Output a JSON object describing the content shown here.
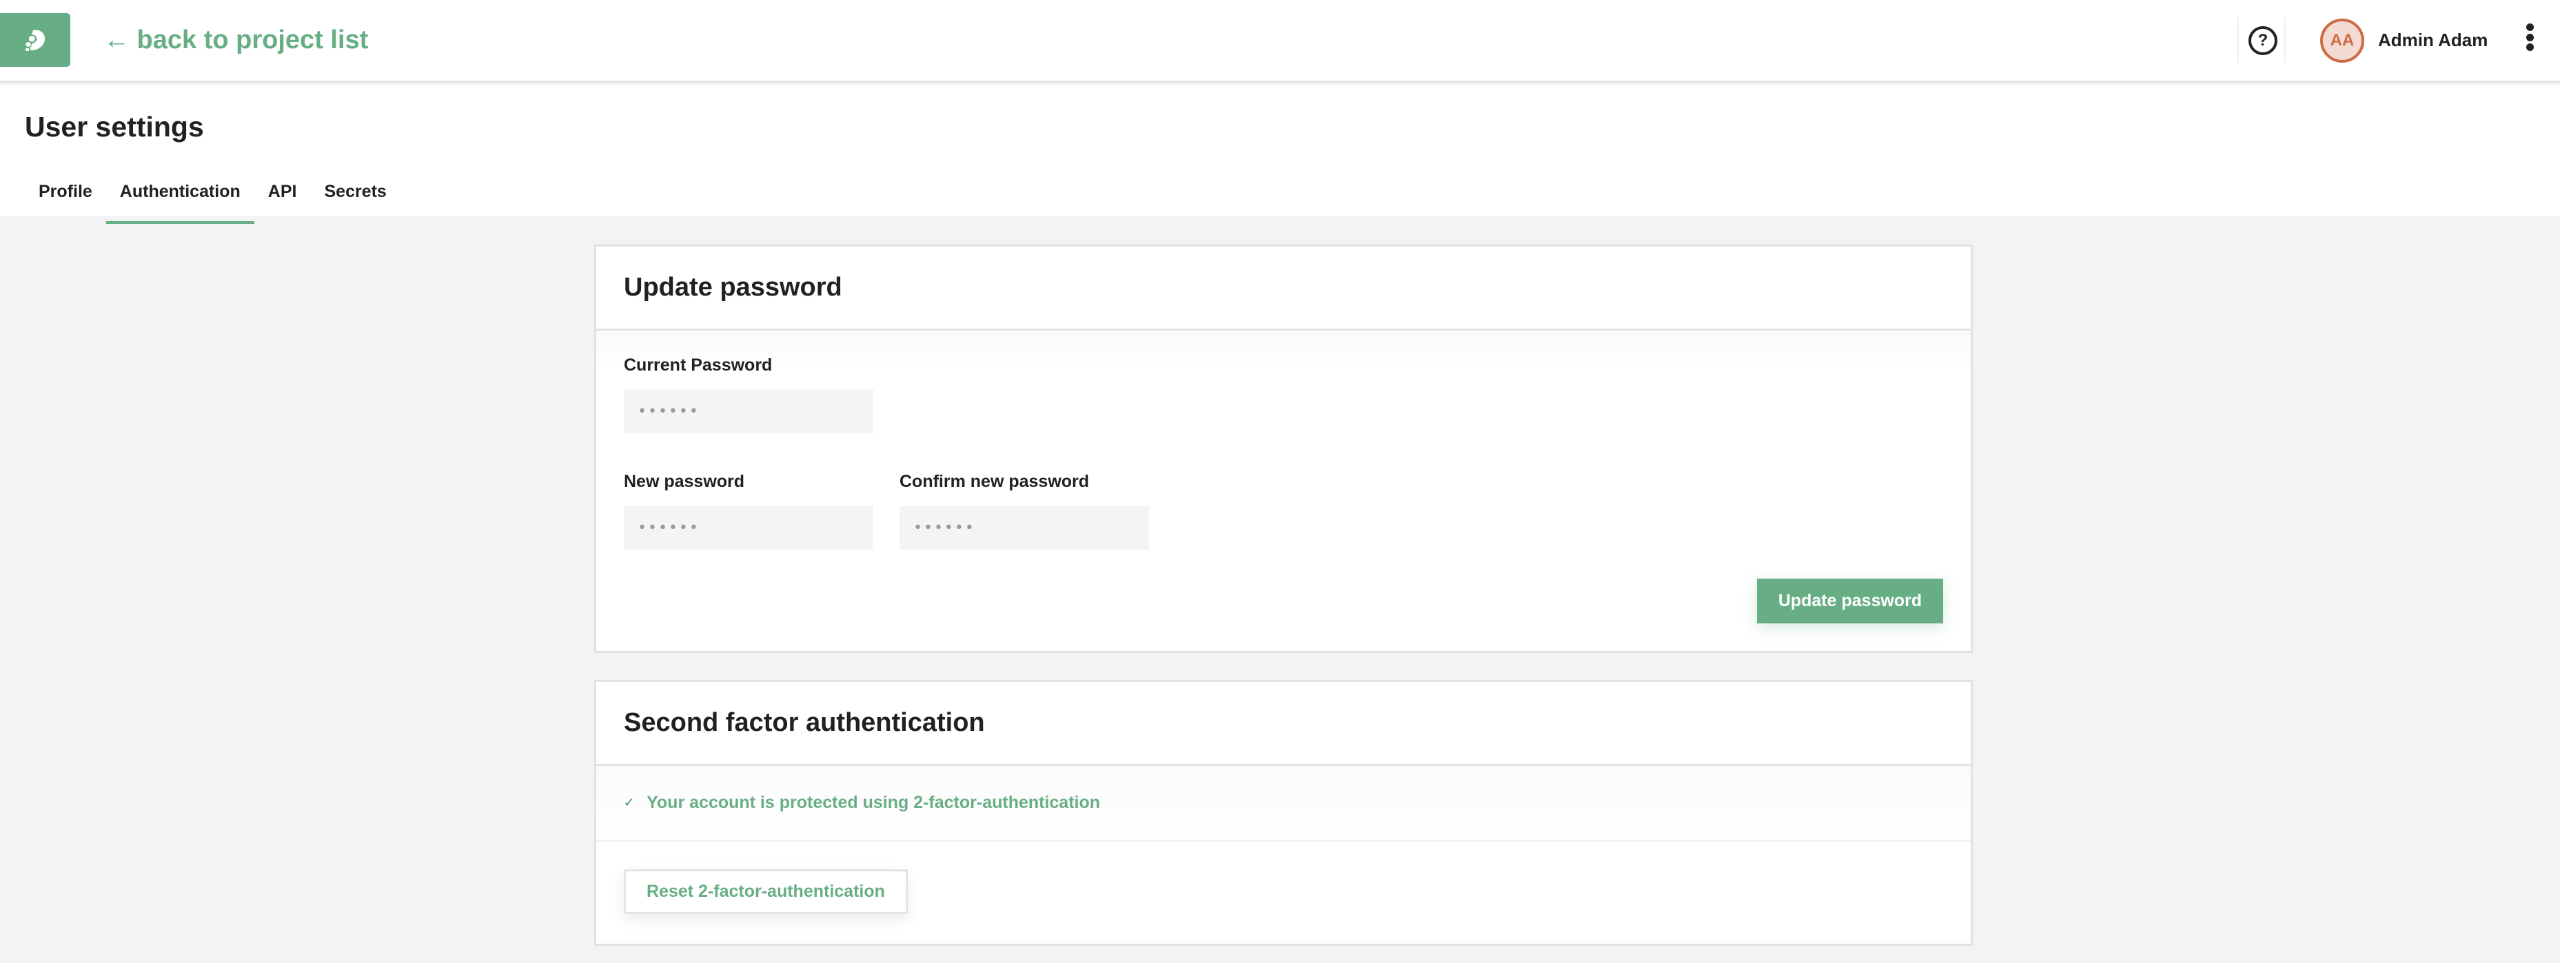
{
  "topbar": {
    "back_link": "← back to project list",
    "help_icon": "question-circle-icon",
    "user": {
      "initials": "AA",
      "name": "Admin Adam"
    },
    "menu_icon": "kebab-vertical-icon",
    "logo_icon": "hop-cone-logo"
  },
  "page": {
    "title": "User settings",
    "tabs": [
      {
        "label": "Profile",
        "active": false
      },
      {
        "label": "Authentication",
        "active": true
      },
      {
        "label": "API",
        "active": false
      },
      {
        "label": "Secrets",
        "active": false
      }
    ]
  },
  "update_password": {
    "title": "Update password",
    "current_label": "Current Password",
    "current_value": "••••••",
    "new_label": "New password",
    "new_value": "••••••",
    "confirm_label": "Confirm new password",
    "confirm_value": "••••••",
    "submit_label": "Update password"
  },
  "two_factor": {
    "title": "Second factor authentication",
    "status_icon": "check-icon",
    "status_text": "Your account is protected using 2-factor-authentication",
    "reset_label": "Reset 2-factor-authentication"
  },
  "colors": {
    "accent": "#68ae84",
    "avatar": "#cf6a47",
    "background": "#f3f3f3"
  }
}
